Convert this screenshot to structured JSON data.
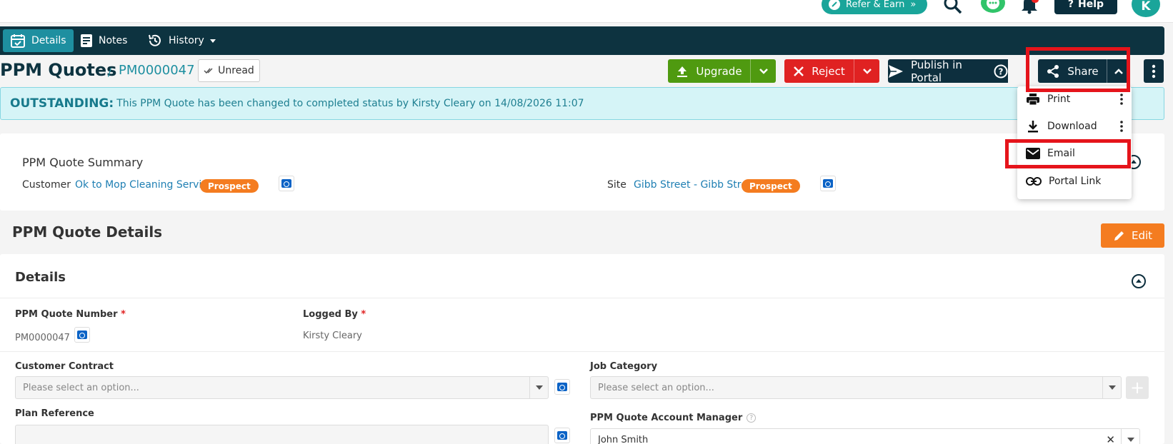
{
  "topbar": {
    "refer_label": "Refer & Earn",
    "refer_chevron": "»",
    "help_label": "Help",
    "avatar_initial": "K"
  },
  "nav": {
    "tabs": [
      {
        "label": "Details",
        "icon": "calendar-check-icon",
        "active": true
      },
      {
        "label": "Notes",
        "icon": "note-icon",
        "active": false
      },
      {
        "label": "History",
        "icon": "history-icon",
        "active": false
      }
    ]
  },
  "header": {
    "title": "PPM Quotes",
    "separator": "/",
    "reference": "PM0000047",
    "unread_label": "Unread",
    "upgrade_label": "Upgrade",
    "reject_label": "Reject",
    "publish_label": "Publish in Portal",
    "share_label": "Share"
  },
  "banner": {
    "status": "OUTSTANDING:",
    "message": "This PPM Quote has been changed to completed status by Kirsty Cleary on 14/08/2026 11:07"
  },
  "summary": {
    "title": "PPM Quote Summary",
    "customer_label": "Customer",
    "customer_value": "Ok to Mop Cleaning Services",
    "customer_badge": "Prospect",
    "site_label": "Site",
    "site_value": "Gibb Street - Gibb Street",
    "site_badge": "Prospect"
  },
  "details_section": {
    "heading": "PPM Quote Details",
    "edit_label": "Edit",
    "card_title": "Details",
    "fields": {
      "quote_number_label": "PPM Quote Number",
      "quote_number_value": "PM0000047",
      "logged_by_label": "Logged By",
      "logged_by_value": "Kirsty Cleary",
      "customer_contract_label": "Customer Contract",
      "customer_contract_placeholder": "Please select an option...",
      "job_category_label": "Job Category",
      "job_category_placeholder": "Please select an option...",
      "plan_reference_label": "Plan Reference",
      "plan_reference_value": "",
      "account_manager_label": "PPM Quote Account Manager",
      "account_manager_value": "John Smith"
    },
    "required_mark": "*",
    "help_mark": "?"
  },
  "share_menu": {
    "items": [
      {
        "label": "Print",
        "icon": "printer-icon"
      },
      {
        "label": "Download",
        "icon": "download-icon"
      },
      {
        "label": "Email",
        "icon": "mail-icon"
      },
      {
        "label": "Portal Link",
        "icon": "link-icon"
      }
    ]
  },
  "colors": {
    "navy": "#0d3340",
    "teal": "#1e8fa0",
    "green": "#4f9a10",
    "red": "#e02222",
    "orange": "#f47c20",
    "highlight": "#e5141b"
  }
}
